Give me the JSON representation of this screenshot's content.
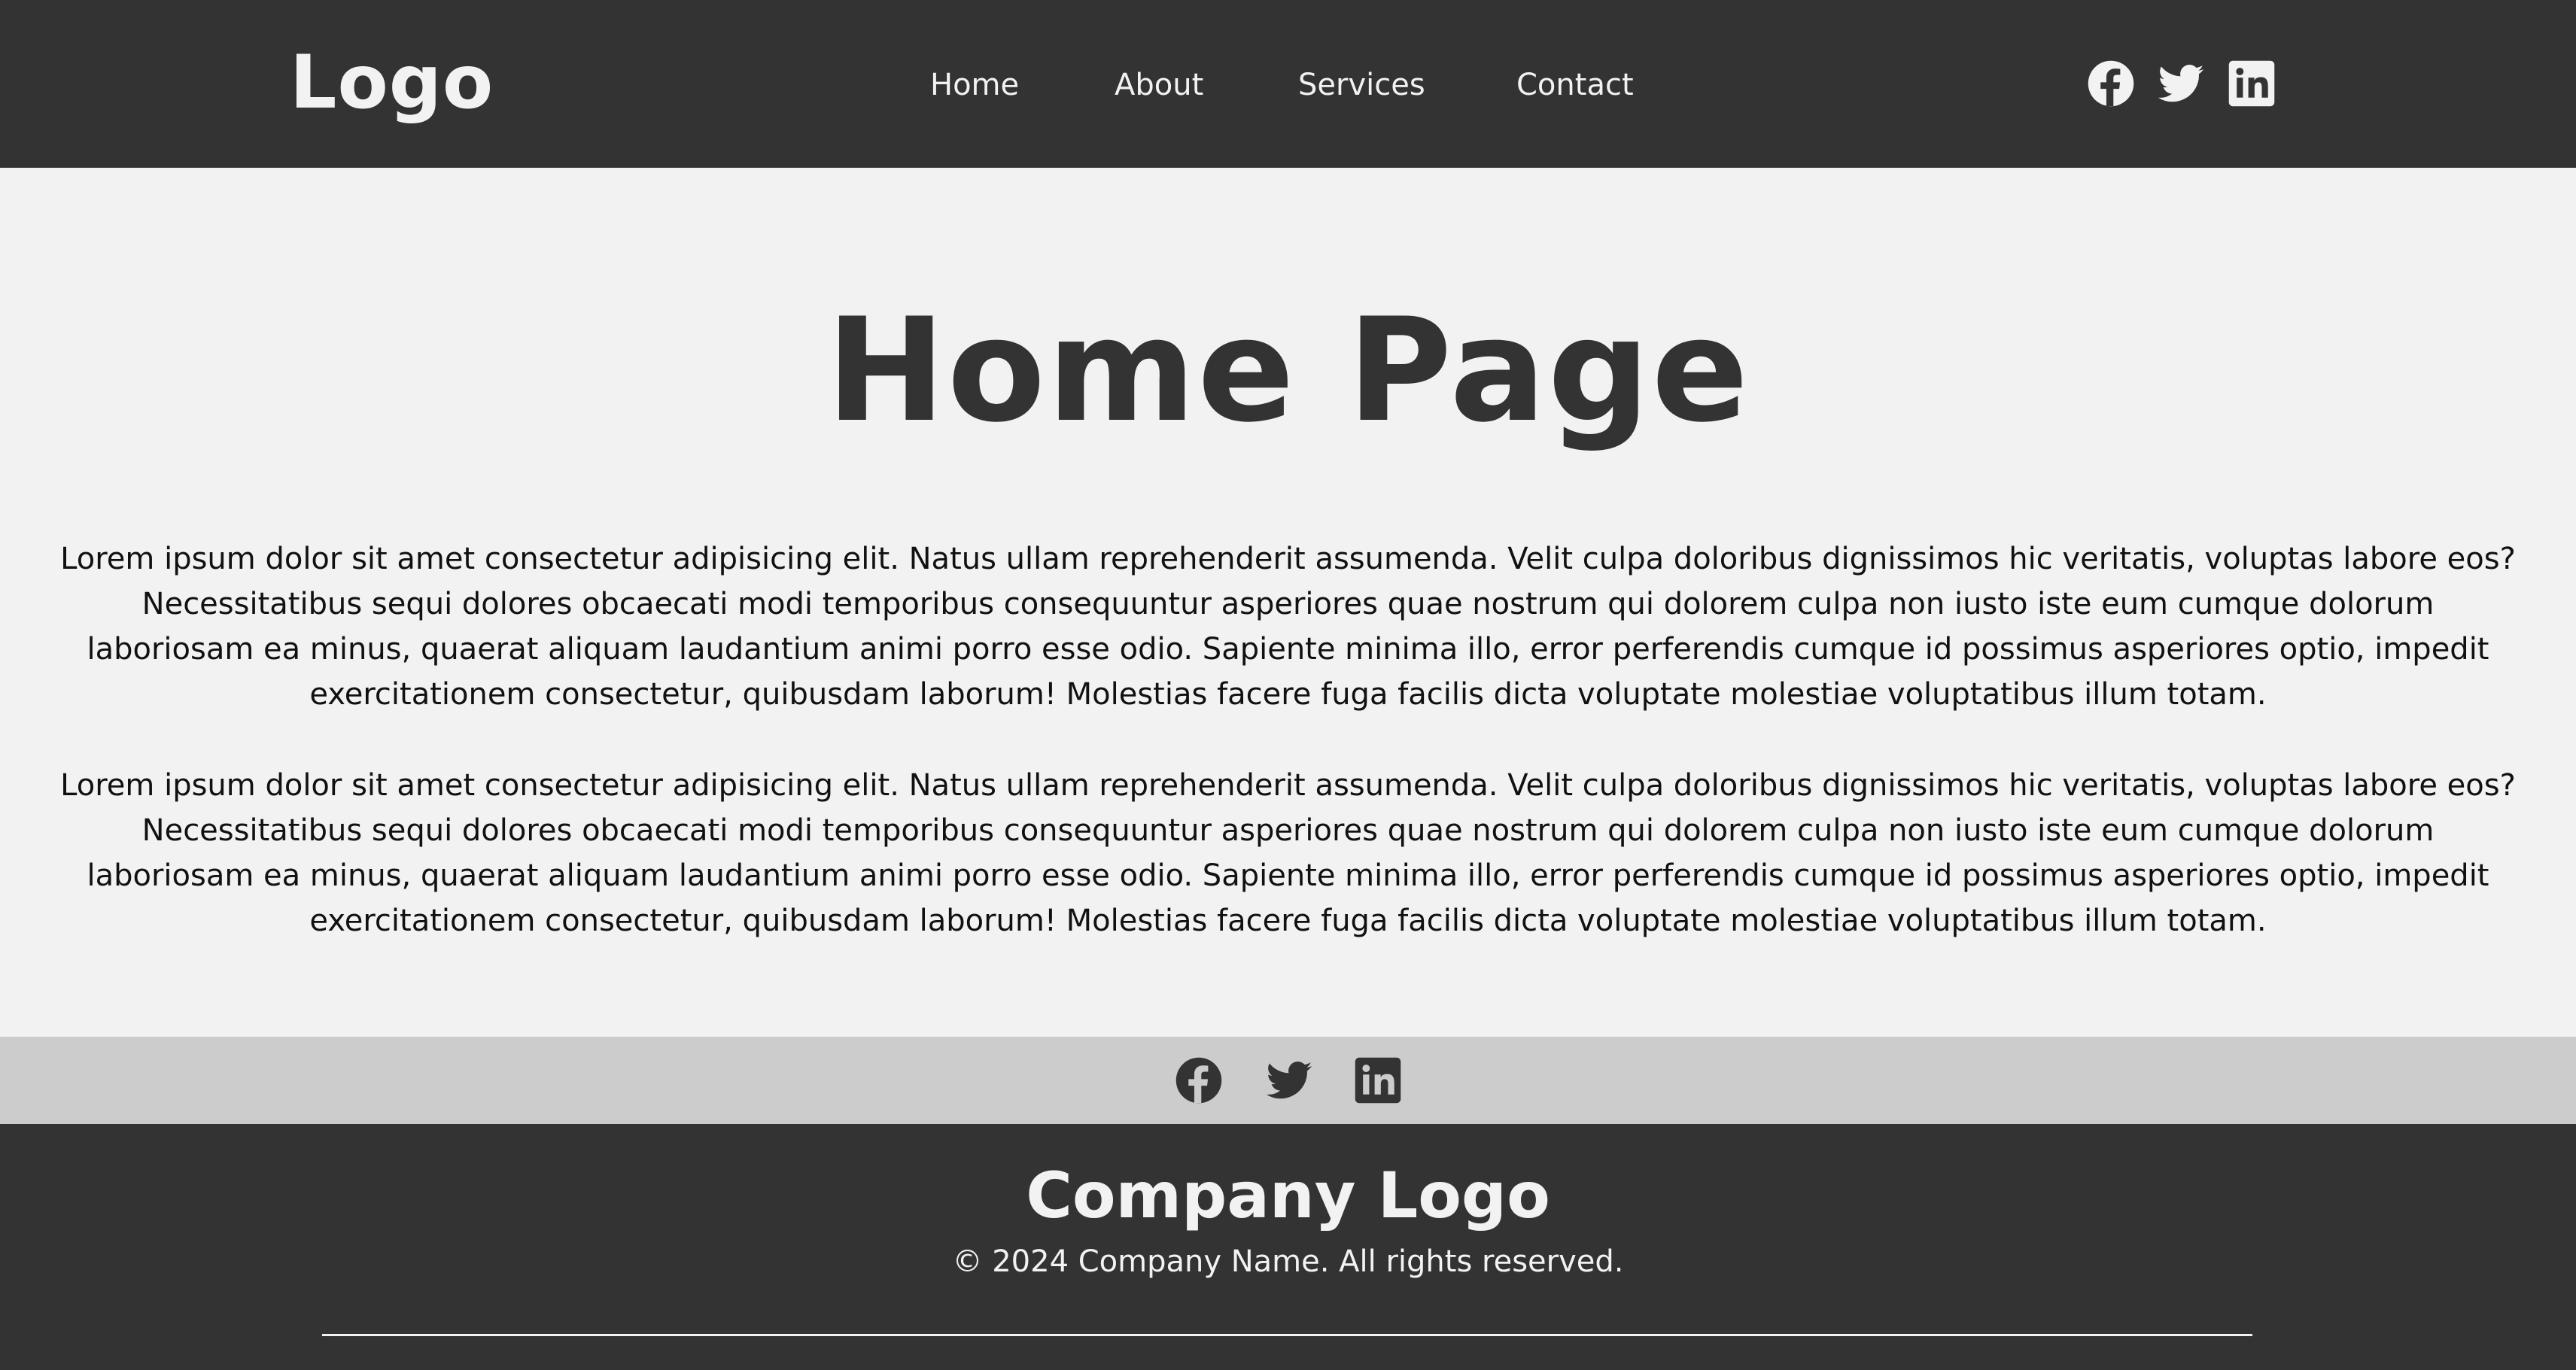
{
  "header": {
    "logo": "Logo",
    "nav": [
      "Home",
      "About",
      "Services",
      "Contact"
    ],
    "social_icons": [
      "facebook-icon",
      "twitter-icon",
      "linkedin-icon"
    ]
  },
  "main": {
    "title": "Home Page",
    "paragraphs": [
      "Lorem ipsum dolor sit amet consectetur adipisicing elit. Natus ullam reprehenderit assumenda. Velit culpa doloribus dignissimos hic veritatis, voluptas labore eos? Necessitatibus sequi dolores obcaecati modi temporibus consequuntur asperiores quae nostrum qui dolorem culpa non iusto iste eum cumque dolorum laboriosam ea minus, quaerat aliquam laudantium animi porro esse odio. Sapiente minima illo, error perferendis cumque id possimus asperiores optio, impedit exercitationem consectetur, quibusdam laborum! Molestias facere fuga facilis dicta voluptate molestiae voluptatibus illum totam.",
      "Lorem ipsum dolor sit amet consectetur adipisicing elit. Natus ullam reprehenderit assumenda. Velit culpa doloribus dignissimos hic veritatis, voluptas labore eos? Necessitatibus sequi dolores obcaecati modi temporibus consequuntur asperiores quae nostrum qui dolorem culpa non iusto iste eum cumque dolorum laboriosam ea minus, quaerat aliquam laudantium animi porro esse odio. Sapiente minima illo, error perferendis cumque id possimus asperiores optio, impedit exercitationem consectetur, quibusdam laborum! Molestias facere fuga facilis dicta voluptate molestiae voluptatibus illum totam."
    ]
  },
  "social_strip": {
    "icons": [
      "facebook-icon",
      "twitter-icon",
      "linkedin-icon"
    ]
  },
  "footer": {
    "logo": "Company Logo",
    "copyright": "© 2024 Company Name. All rights reserved."
  },
  "colors": {
    "dark": "#333333",
    "light": "#f2f2f2",
    "strip": "#cccccc"
  }
}
